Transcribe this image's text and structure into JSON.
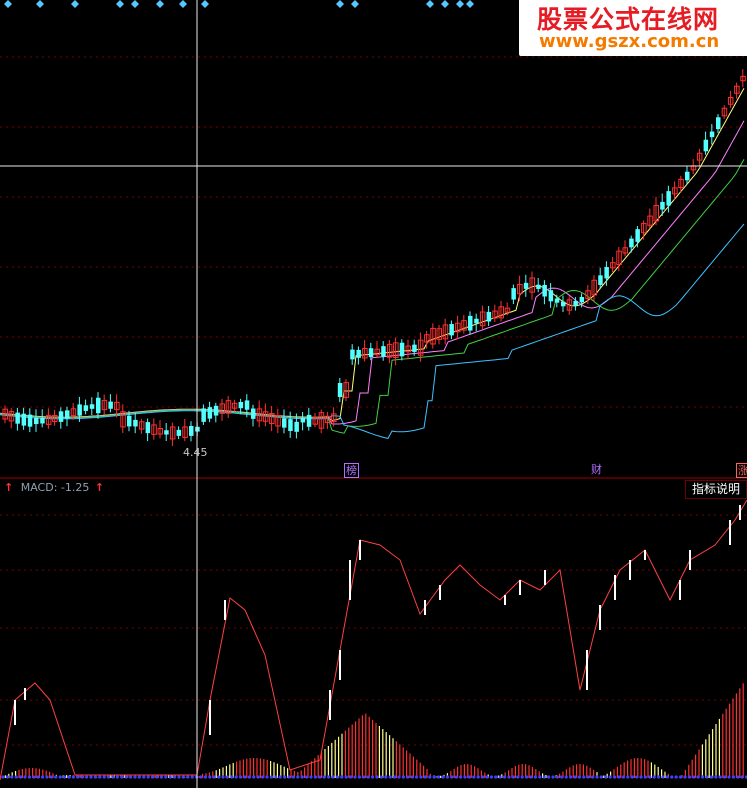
{
  "watermark": {
    "title": "股票公式在线网",
    "url": "www.gszx.com.cn"
  },
  "main_panel": {
    "low_label": "4.45",
    "markers": [
      {
        "text": "榜",
        "color": "#b070ff"
      },
      {
        "text": "财",
        "color": "#b070ff"
      },
      {
        "text": "涨",
        "color": "#ff6060"
      }
    ]
  },
  "macd_panel": {
    "label": "MACD: -1.25",
    "button": "指标说明"
  },
  "chart_data": [
    {
      "type": "candlestick",
      "title": "",
      "series": [
        {
          "name": "",
          "color": "#ffff80"
        },
        {
          "name": "",
          "color": "#ff80ff"
        },
        {
          "name": "",
          "color": "#40d040"
        },
        {
          "name": "",
          "color": "#40c0ff"
        }
      ],
      "annotations": [
        "4.45"
      ],
      "grid": true
    },
    {
      "type": "bar",
      "title": "MACD",
      "value_label": "MACD: -1.25",
      "series": [
        {
          "name": "",
          "color": "#ff4040"
        },
        {
          "name": "",
          "color": "#ffffff"
        }
      ]
    }
  ]
}
